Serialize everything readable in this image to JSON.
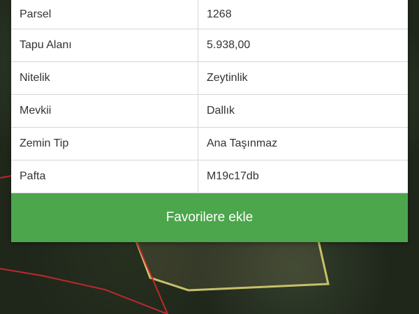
{
  "details": [
    {
      "label": "Parsel",
      "value": "1268"
    },
    {
      "label": "Tapu Alanı",
      "value": "5.938,00"
    },
    {
      "label": "Nitelik",
      "value": "Zeytinlik"
    },
    {
      "label": "Mevkii",
      "value": "Dallık"
    },
    {
      "label": "Zemin Tip",
      "value": "Ana Taşınmaz"
    },
    {
      "label": "Pafta",
      "value": "M19c17db"
    }
  ],
  "actions": {
    "favorite_label": "Favorilere ekle"
  },
  "colors": {
    "accent": "#4ca64c",
    "parcel_outline": "#c8c06a",
    "border_line": "#c0282d"
  }
}
